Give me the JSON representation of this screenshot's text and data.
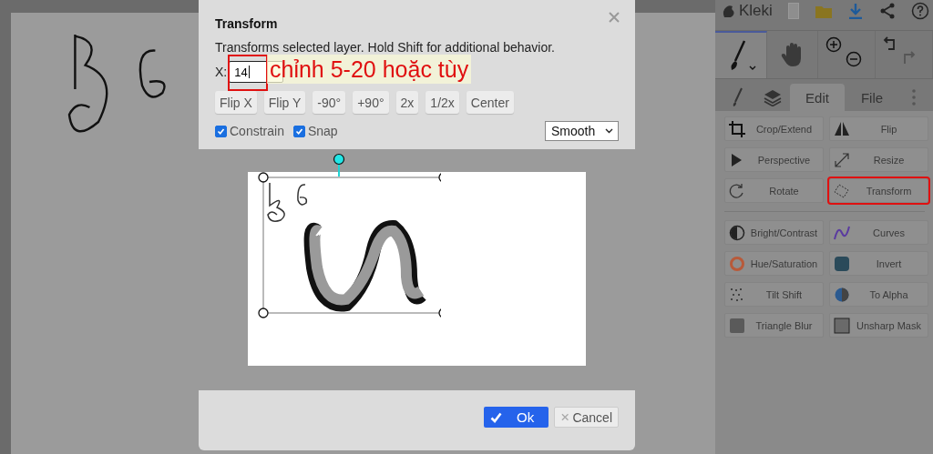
{
  "dialog": {
    "title": "Transform",
    "description": "Transforms selected layer. Hold Shift for additional behavior.",
    "x_field": {
      "label": "X:",
      "value": "14"
    },
    "buttons": [
      "Flip X",
      "Flip Y",
      "-90°",
      "+90°",
      "2x",
      "1/2x",
      "Center"
    ],
    "checkboxes": [
      {
        "label": "Constrain",
        "checked": true
      },
      {
        "label": "Snap",
        "checked": true
      }
    ],
    "interpolation": "Smooth",
    "ok": "Ok",
    "cancel": "Cancel"
  },
  "annotation": {
    "text": "chỉnh 5-20 hoặc tùy"
  },
  "sidebar": {
    "logo": "Kleki",
    "tools": [
      {
        "kind": "brush",
        "selected": true
      },
      {
        "kind": "hand",
        "selected": false
      }
    ],
    "tabs": [
      {
        "kind": "brush",
        "selected": false
      },
      {
        "kind": "layers",
        "selected": false
      },
      {
        "kind": "text",
        "label": "Edit",
        "selected": true
      },
      {
        "kind": "text",
        "label": "File",
        "selected": false
      }
    ],
    "groups": [
      [
        {
          "label": "Crop/Extend",
          "highlighted": false
        },
        {
          "label": "Flip",
          "highlighted": false
        },
        {
          "label": "Perspective",
          "highlighted": false
        },
        {
          "label": "Resize",
          "highlighted": false
        },
        {
          "label": "Rotate",
          "highlighted": false
        },
        {
          "label": "Transform",
          "highlighted": true
        }
      ],
      [
        {
          "label": "Bright/Contrast",
          "highlighted": false
        },
        {
          "label": "Curves",
          "highlighted": false
        },
        {
          "label": "Hue/Saturation",
          "highlighted": false
        },
        {
          "label": "Invert",
          "highlighted": false
        },
        {
          "label": "Tilt Shift",
          "highlighted": false
        },
        {
          "label": "To Alpha",
          "highlighted": false
        },
        {
          "label": "Triangle Blur",
          "highlighted": false
        },
        {
          "label": "Unsharp Mask",
          "highlighted": false
        }
      ]
    ]
  }
}
